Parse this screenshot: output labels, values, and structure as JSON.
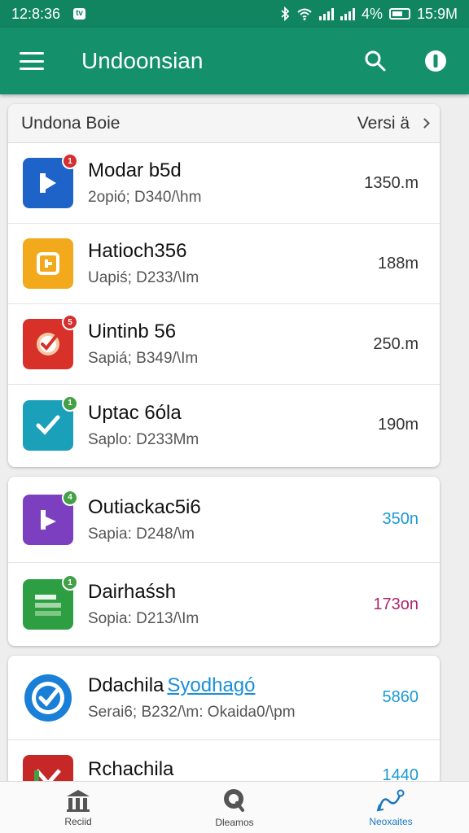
{
  "status_bar": {
    "time": "12:8:36",
    "tv_badge": "tv",
    "battery": "4%",
    "clock_right": "15:9M"
  },
  "app_bar": {
    "title": "Undoonsian",
    "icons": [
      "menu-icon",
      "search-icon",
      "info-icon"
    ]
  },
  "list_header": {
    "left": "Undona Boie",
    "right": "Versi ä"
  },
  "groups": [
    {
      "items": [
        {
          "name": "Modar b5d",
          "sub": "2opió; D340/\\hm",
          "size": "1350.m",
          "icon": "blue-play-icon",
          "color": "#1e63c8"
        },
        {
          "name": "Hatioch356",
          "sub": "Uapiś; D233/\\Im",
          "size": "188m",
          "icon": "yellow-square-icon",
          "color": "#f2aa1c"
        },
        {
          "name": "Uintinb 56",
          "sub": "Sapiá; B349/\\Im",
          "size": "250.m",
          "icon": "red-check-icon",
          "color": "#d7312a"
        },
        {
          "name": "Uptac 6óla",
          "sub": "Saplo: D233Mm",
          "size": "190m",
          "icon": "teal-check-icon",
          "color": "#1aa0b8"
        }
      ]
    },
    {
      "items": [
        {
          "name": "Outiackac5i6",
          "sub": "Sapia: D248/\\m",
          "size": "350n",
          "icon": "purple-play-icon",
          "color": "#7b3fc0",
          "size_color": "#1a9ad6"
        },
        {
          "name": "Dairhaśsh",
          "sub": "Sopia: D213/\\Im",
          "size": "173on",
          "icon": "green-sheet-icon",
          "color": "#2e9e43",
          "size_color": "#b0256e"
        }
      ]
    },
    {
      "items": [
        {
          "name": "Ddachila",
          "link": "Syodhagó",
          "sub": "Serai6; B232/\\m: Okaida0/\\pm",
          "size": "5860",
          "icon": "blue-check-circle-icon",
          "color": "#1a7fd6",
          "size_color": "#1a9ad6"
        },
        {
          "name": "Rchachila",
          "sub": "",
          "size": "1440",
          "icon": "red-mail-icon",
          "color": "#c62828",
          "size_color": "#1a9ad6"
        }
      ]
    }
  ],
  "bottom_nav": [
    {
      "label": "Reciid",
      "icon": "bank-icon"
    },
    {
      "label": "Dleamos",
      "icon": "search-q-icon"
    },
    {
      "label": "Neoxaites",
      "icon": "route-icon",
      "active": true
    }
  ]
}
